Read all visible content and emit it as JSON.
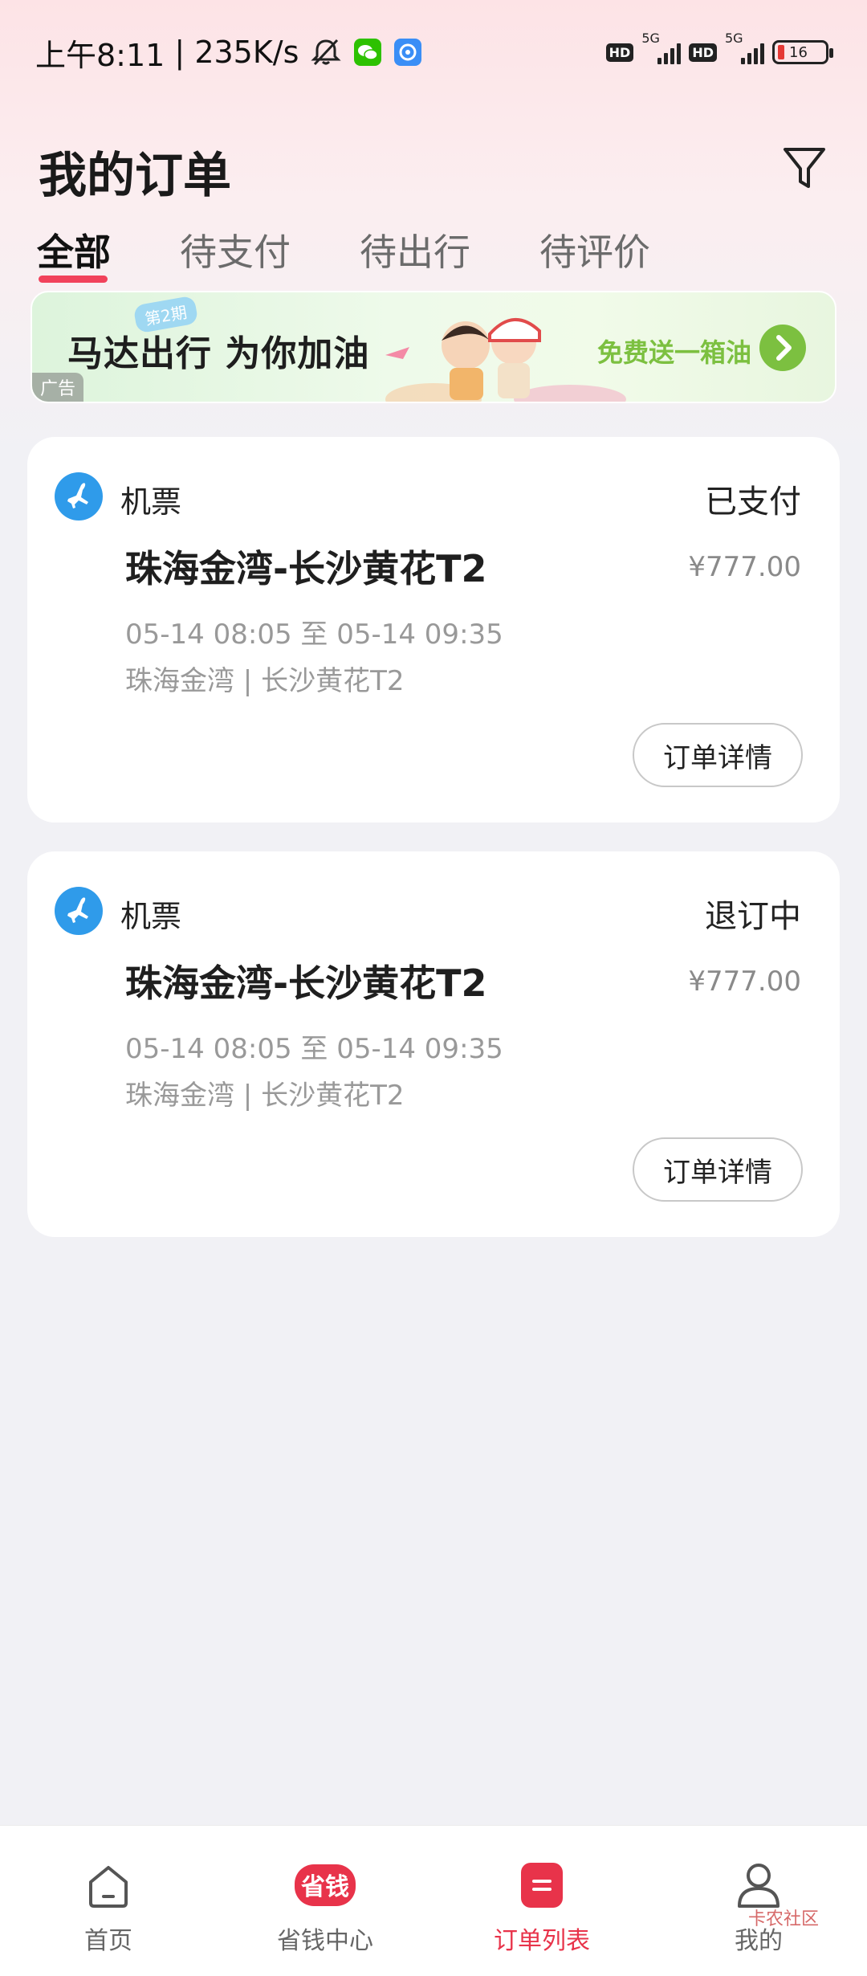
{
  "status_bar": {
    "time": "上午8:11",
    "speed": "235K/s",
    "hd1": "HD",
    "net1": "5G",
    "hd2": "HD",
    "net2": "5G",
    "battery": "16",
    "icons": [
      "mute-icon",
      "wechat-icon",
      "app-icon",
      "signal-icon",
      "battery-icon"
    ]
  },
  "header": {
    "title": "我的订单",
    "filter_icon": "filter-icon"
  },
  "tabs": [
    {
      "label": "全部",
      "active": true
    },
    {
      "label": "待支付",
      "active": false
    },
    {
      "label": "待出行",
      "active": false
    },
    {
      "label": "待评价",
      "active": false
    }
  ],
  "ad": {
    "title": "马达出行 为你加油",
    "tag": "第2期",
    "label": "广告",
    "cta": "免费送一箱油"
  },
  "orders": [
    {
      "type": "机票",
      "status": "已支付",
      "route": "珠海金湾-长沙黄花T2",
      "price": "¥777.00",
      "time": "05-14 08:05 至 05-14 09:35",
      "airports": "珠海金湾 | 长沙黄花T2",
      "button": "订单详情"
    },
    {
      "type": "机票",
      "status": "退订中",
      "route": "珠海金湾-长沙黄花T2",
      "price": "¥777.00",
      "time": "05-14 08:05 至 05-14 09:35",
      "airports": "珠海金湾 | 长沙黄花T2",
      "button": "订单详情"
    }
  ],
  "bottom_nav": [
    {
      "label": "首页",
      "icon": "home-icon"
    },
    {
      "label": "省钱中心",
      "icon": "save-money-icon",
      "icon_text": "省钱"
    },
    {
      "label": "订单列表",
      "icon": "order-list-icon",
      "active": true
    },
    {
      "label": "我的",
      "icon": "profile-icon"
    }
  ],
  "watermark": "卡农社区",
  "colors": {
    "accent": "#e8334a",
    "ad_green": "#7cc040",
    "plane_blue": "#2f9bea"
  }
}
